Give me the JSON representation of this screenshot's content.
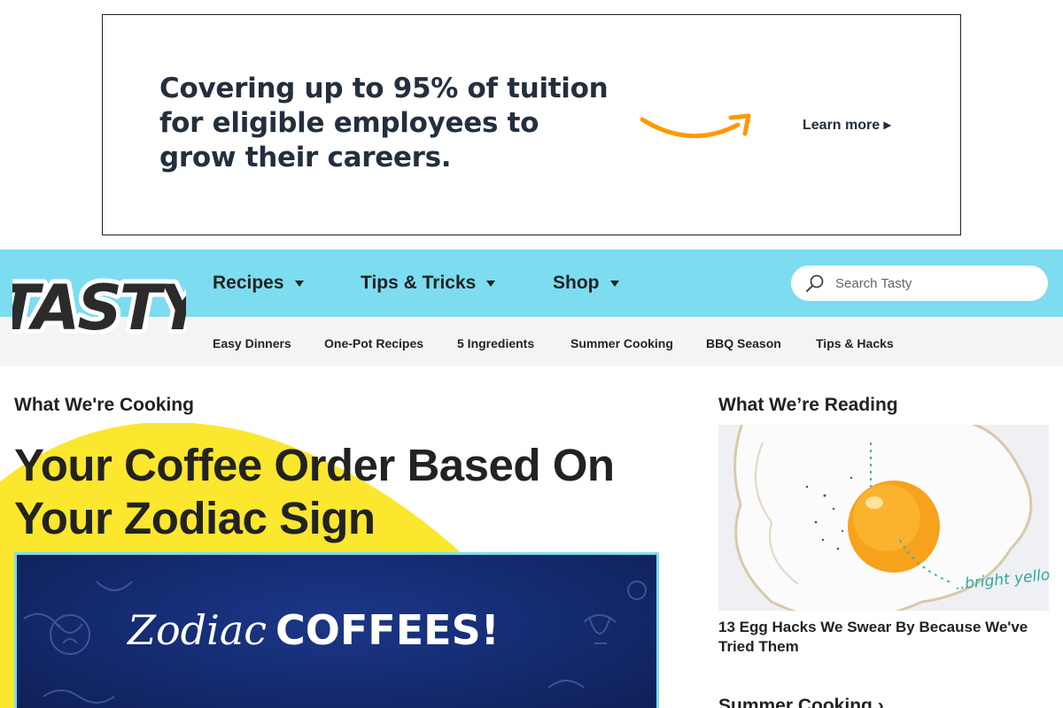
{
  "ad": {
    "headline": "Covering up to 95% of tuition for eligible employees to grow their careers.",
    "cta": "Learn more ▸",
    "brand_color": "#ff9900",
    "text_color": "#232f3e"
  },
  "header": {
    "logo_text": "TASTY",
    "nav_color": "#7ddcf0",
    "nav": [
      {
        "label": "Recipes"
      },
      {
        "label": "Tips & Tricks"
      },
      {
        "label": "Shop"
      }
    ],
    "search": {
      "placeholder": "Search Tasty",
      "icon": "search-icon"
    },
    "sub_nav": [
      "Easy Dinners",
      "One-Pot Recipes",
      "5 Ingredients",
      "Summer Cooking",
      "BBQ Season",
      "Tips & Hacks"
    ]
  },
  "main": {
    "section_title": "What We're Cooking",
    "feature_title": "Your Coffee Order Based On Your Zodiac Sign",
    "feature_image_text": {
      "part1": "Zodiac",
      "part2": "COFFEES!"
    },
    "accent_yellow": "#fbe72e"
  },
  "sidebar": {
    "section_title": "What We’re Reading",
    "image_annotation": "..bright yellow, runny yolk",
    "caption": "13 Egg Hacks We Swear By Because We've Tried Them",
    "next_section": "Summer Cooking ›"
  }
}
